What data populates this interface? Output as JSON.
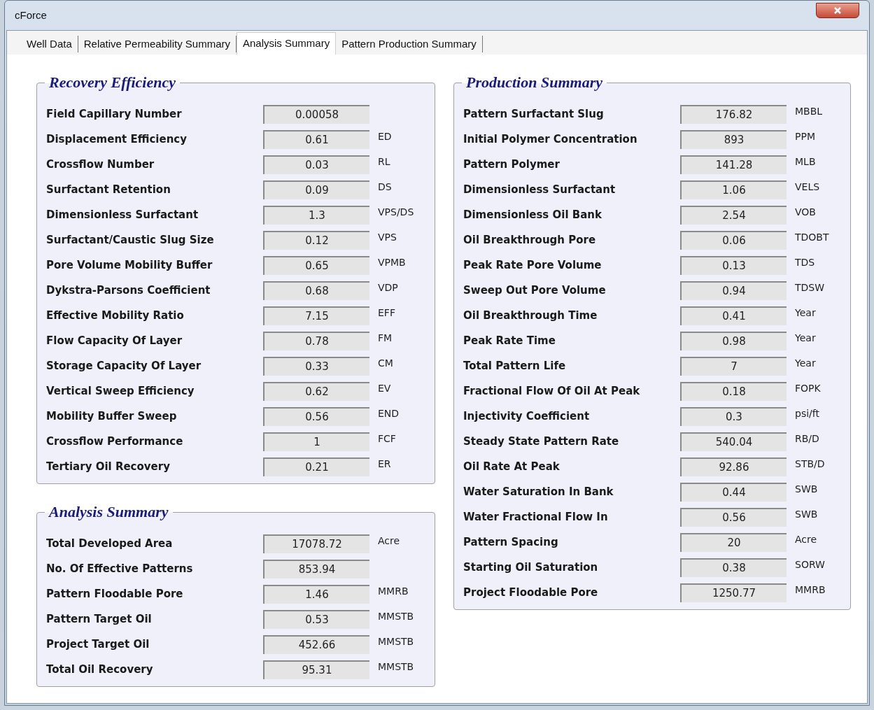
{
  "window": {
    "title": "cForce"
  },
  "tabs": [
    {
      "label": "Well Data",
      "selected": false
    },
    {
      "label": "Relative Permeability Summary",
      "selected": false
    },
    {
      "label": "Analysis Summary",
      "selected": true
    },
    {
      "label": "Pattern Production Summary",
      "selected": false
    }
  ],
  "recovery_efficiency": {
    "title": "Recovery Efficiency",
    "rows": [
      {
        "label": "Field Capillary Number",
        "value": "0.00058"
      },
      {
        "label": "Displacement Efficiency",
        "value": "0.61",
        "unit": "ED"
      },
      {
        "label": "Crossflow Number",
        "value": "0.03",
        "unit": "RL"
      },
      {
        "label": "Surfactant Retention",
        "value": "0.09",
        "unit": "DS"
      },
      {
        "label": "Dimensionless Surfactant",
        "value": "1.3",
        "unit": "VPS/DS"
      },
      {
        "label": "Surfactant/Caustic Slug Size",
        "value": "0.12",
        "unit": "VPS"
      },
      {
        "label": "Pore Volume Mobility Buffer",
        "value": "0.65",
        "unit": "VPMB"
      },
      {
        "label": "Dykstra-Parsons Coefficient",
        "value": "0.68",
        "unit": "VDP"
      },
      {
        "label": "Effective Mobility Ratio",
        "value": "7.15",
        "unit": "EFF"
      },
      {
        "label": "Flow Capacity Of Layer",
        "value": "0.78",
        "unit": "FM"
      },
      {
        "label": "Storage Capacity Of Layer",
        "value": "0.33",
        "unit": "CM"
      },
      {
        "label": "Vertical Sweep Efficiency",
        "value": "0.62",
        "unit": "EV"
      },
      {
        "label": "Mobility Buffer Sweep",
        "value": "0.56",
        "unit": "END"
      },
      {
        "label": "Crossflow Performance",
        "value": "1",
        "unit": "FCF"
      },
      {
        "label": "Tertiary Oil Recovery",
        "value": "0.21",
        "unit": "ER"
      }
    ]
  },
  "analysis_summary": {
    "title": "Analysis Summary",
    "rows": [
      {
        "label": "Total Developed Area",
        "value": "17078.72",
        "unit": "Acre"
      },
      {
        "label": "No. Of Effective Patterns",
        "value": "853.94"
      },
      {
        "label": "Pattern Floodable Pore",
        "value": "1.46",
        "unit": "MMRB"
      },
      {
        "label": "Pattern Target Oil",
        "value": "0.53",
        "unit": "MMSTB"
      },
      {
        "label": "Project Target Oil",
        "value": "452.66",
        "unit": "MMSTB"
      },
      {
        "label": "Total Oil Recovery",
        "value": "95.31",
        "unit": "MMSTB"
      }
    ]
  },
  "production_summary": {
    "title": "Production Summary",
    "rows": [
      {
        "label": "Pattern Surfactant Slug",
        "value": "176.82",
        "unit": "MBBL"
      },
      {
        "label": "Initial Polymer Concentration",
        "value": "893",
        "unit": "PPM"
      },
      {
        "label": "Pattern Polymer",
        "value": "141.28",
        "unit": "MLB"
      },
      {
        "label": "Dimensionless Surfactant",
        "value": "1.06",
        "unit": "VELS"
      },
      {
        "label": "Dimensionless Oil Bank",
        "value": "2.54",
        "unit": "VOB"
      },
      {
        "label": "Oil Breakthrough Pore",
        "value": "0.06",
        "unit": "TDOBT"
      },
      {
        "label": "Peak Rate Pore Volume",
        "value": "0.13",
        "unit": "TDS"
      },
      {
        "label": "Sweep Out Pore Volume",
        "value": "0.94",
        "unit": "TDSW"
      },
      {
        "label": "Oil Breakthrough Time",
        "value": "0.41",
        "unit": "Year"
      },
      {
        "label": "Peak Rate Time",
        "value": "0.98",
        "unit": "Year"
      },
      {
        "label": "Total Pattern Life",
        "value": "7",
        "unit": "Year"
      },
      {
        "label": "Fractional Flow Of Oil At Peak",
        "value": "0.18",
        "unit": "FOPK"
      },
      {
        "label": "Injectivity Coefficient",
        "value": "0.3",
        "unit": "psi/ft"
      },
      {
        "label": "Steady State Pattern Rate",
        "value": "540.04",
        "unit": "RB/D"
      },
      {
        "label": "Oil Rate At Peak",
        "value": "92.86",
        "unit": "STB/D"
      },
      {
        "label": "Water Saturation In Bank",
        "value": "0.44",
        "unit": "SWB"
      },
      {
        "label": "Water Fractional Flow In",
        "value": "0.56",
        "unit": "SWB"
      },
      {
        "label": "Pattern Spacing",
        "value": "20",
        "unit": "Acre"
      },
      {
        "label": "Starting Oil Saturation",
        "value": "0.38",
        "unit": "SORW"
      },
      {
        "label": "Project Floodable Pore",
        "value": "1250.77",
        "unit": "MMRB"
      }
    ]
  }
}
